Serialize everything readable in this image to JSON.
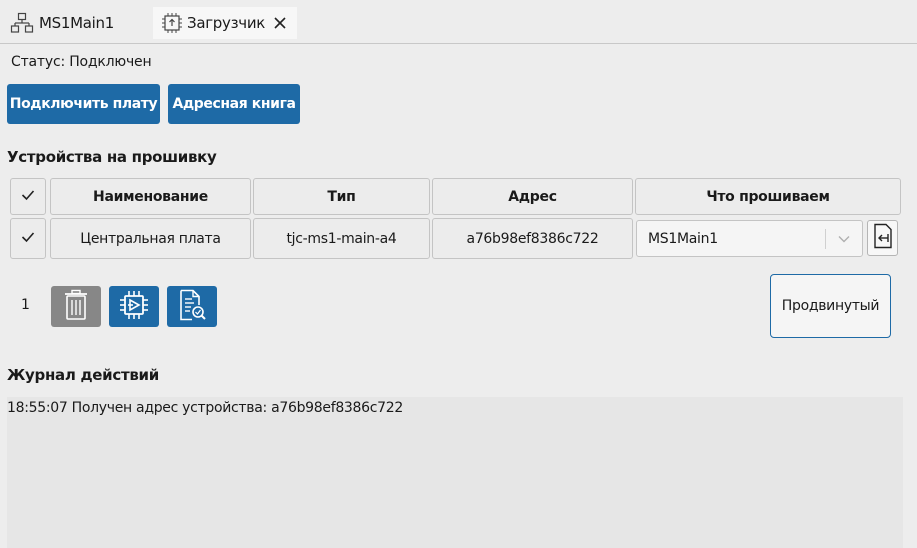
{
  "tabs": [
    {
      "label": "MS1Main1",
      "icon": "network-tree-icon"
    },
    {
      "label": "Загрузчик",
      "icon": "chip-upload-icon",
      "active": true,
      "closable": true
    }
  ],
  "status": {
    "text": "Статус: Подключен"
  },
  "actions": {
    "connect_label": "Подключить плату",
    "address_book_label": "Адресная книга"
  },
  "devices": {
    "title": "Устройства на прошивку",
    "columns": [
      "Наименование",
      "Тип",
      "Адрес",
      "Что прошиваем"
    ],
    "header_checked": true,
    "rows": [
      {
        "checked": true,
        "name": "Центральная плата",
        "type": "tjc-ms1-main-a4",
        "address": "a76b98ef8386c722",
        "firmware": "MS1Main1"
      }
    ],
    "count": "1",
    "advanced_label": "Продвинутый"
  },
  "log": {
    "title": "Журнал действий",
    "lines": [
      "18:55:07 Получен адрес устройства: a76b98ef8386c722"
    ]
  },
  "colors": {
    "accent": "#1e6aa6",
    "delete": "#878787",
    "background": "#ededed"
  }
}
